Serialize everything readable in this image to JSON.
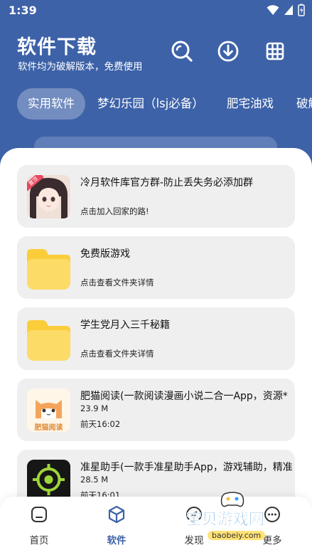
{
  "status": {
    "time": "1:39"
  },
  "header": {
    "title": "软件下载",
    "subtitle": "软件均为破解版本，免费使用",
    "icons": [
      "search-icon",
      "download-icon",
      "grid-icon"
    ]
  },
  "tabs": [
    {
      "label": "实用软件",
      "active": true
    },
    {
      "label": "梦幻乐园（lsj必备）",
      "active": false
    },
    {
      "label": "肥宅油戏",
      "active": false
    },
    {
      "label": "破解",
      "active": false
    }
  ],
  "cards": [
    {
      "title": "冷月软件库官方群-防止丢失务必添加群",
      "line1": "点击加入回家的路!",
      "line2": "",
      "icon": "anime-girl-avatar",
      "badge": "置顶"
    },
    {
      "title": "免费版游戏",
      "line1": "点击查看文件夹详情",
      "line2": "",
      "icon": "folder-icon"
    },
    {
      "title": "学生党月入三千秘籍",
      "line1": "点击查看文件夹详情",
      "line2": "",
      "icon": "folder-icon"
    },
    {
      "title": "肥猫阅读(一款阅读漫画小说二合一App，资源*",
      "line1": "23.9 M",
      "line2": "前天16:02",
      "icon": "cat-app-icon",
      "icon_text": "肥猫阅读"
    },
    {
      "title": "准星助手(一款手准星助手App，游戏辅助，精准",
      "line1": "28.5 M",
      "line2": "前天16:01",
      "icon": "crosshair-app-icon"
    }
  ],
  "bottom_nav": [
    {
      "label": "首页",
      "icon": "home-icon",
      "active": false
    },
    {
      "label": "软件",
      "icon": "box-icon",
      "active": true
    },
    {
      "label": "发现",
      "icon": "compass-icon",
      "active": false
    },
    {
      "label": "更多",
      "icon": "more-icon",
      "active": false
    }
  ],
  "watermark": {
    "text": "宝贝游戏网",
    "url": "baobeiy.com"
  },
  "colors": {
    "primary": "#3d62a8",
    "folder": "#fdd54f",
    "card_bg": "#efefef"
  }
}
